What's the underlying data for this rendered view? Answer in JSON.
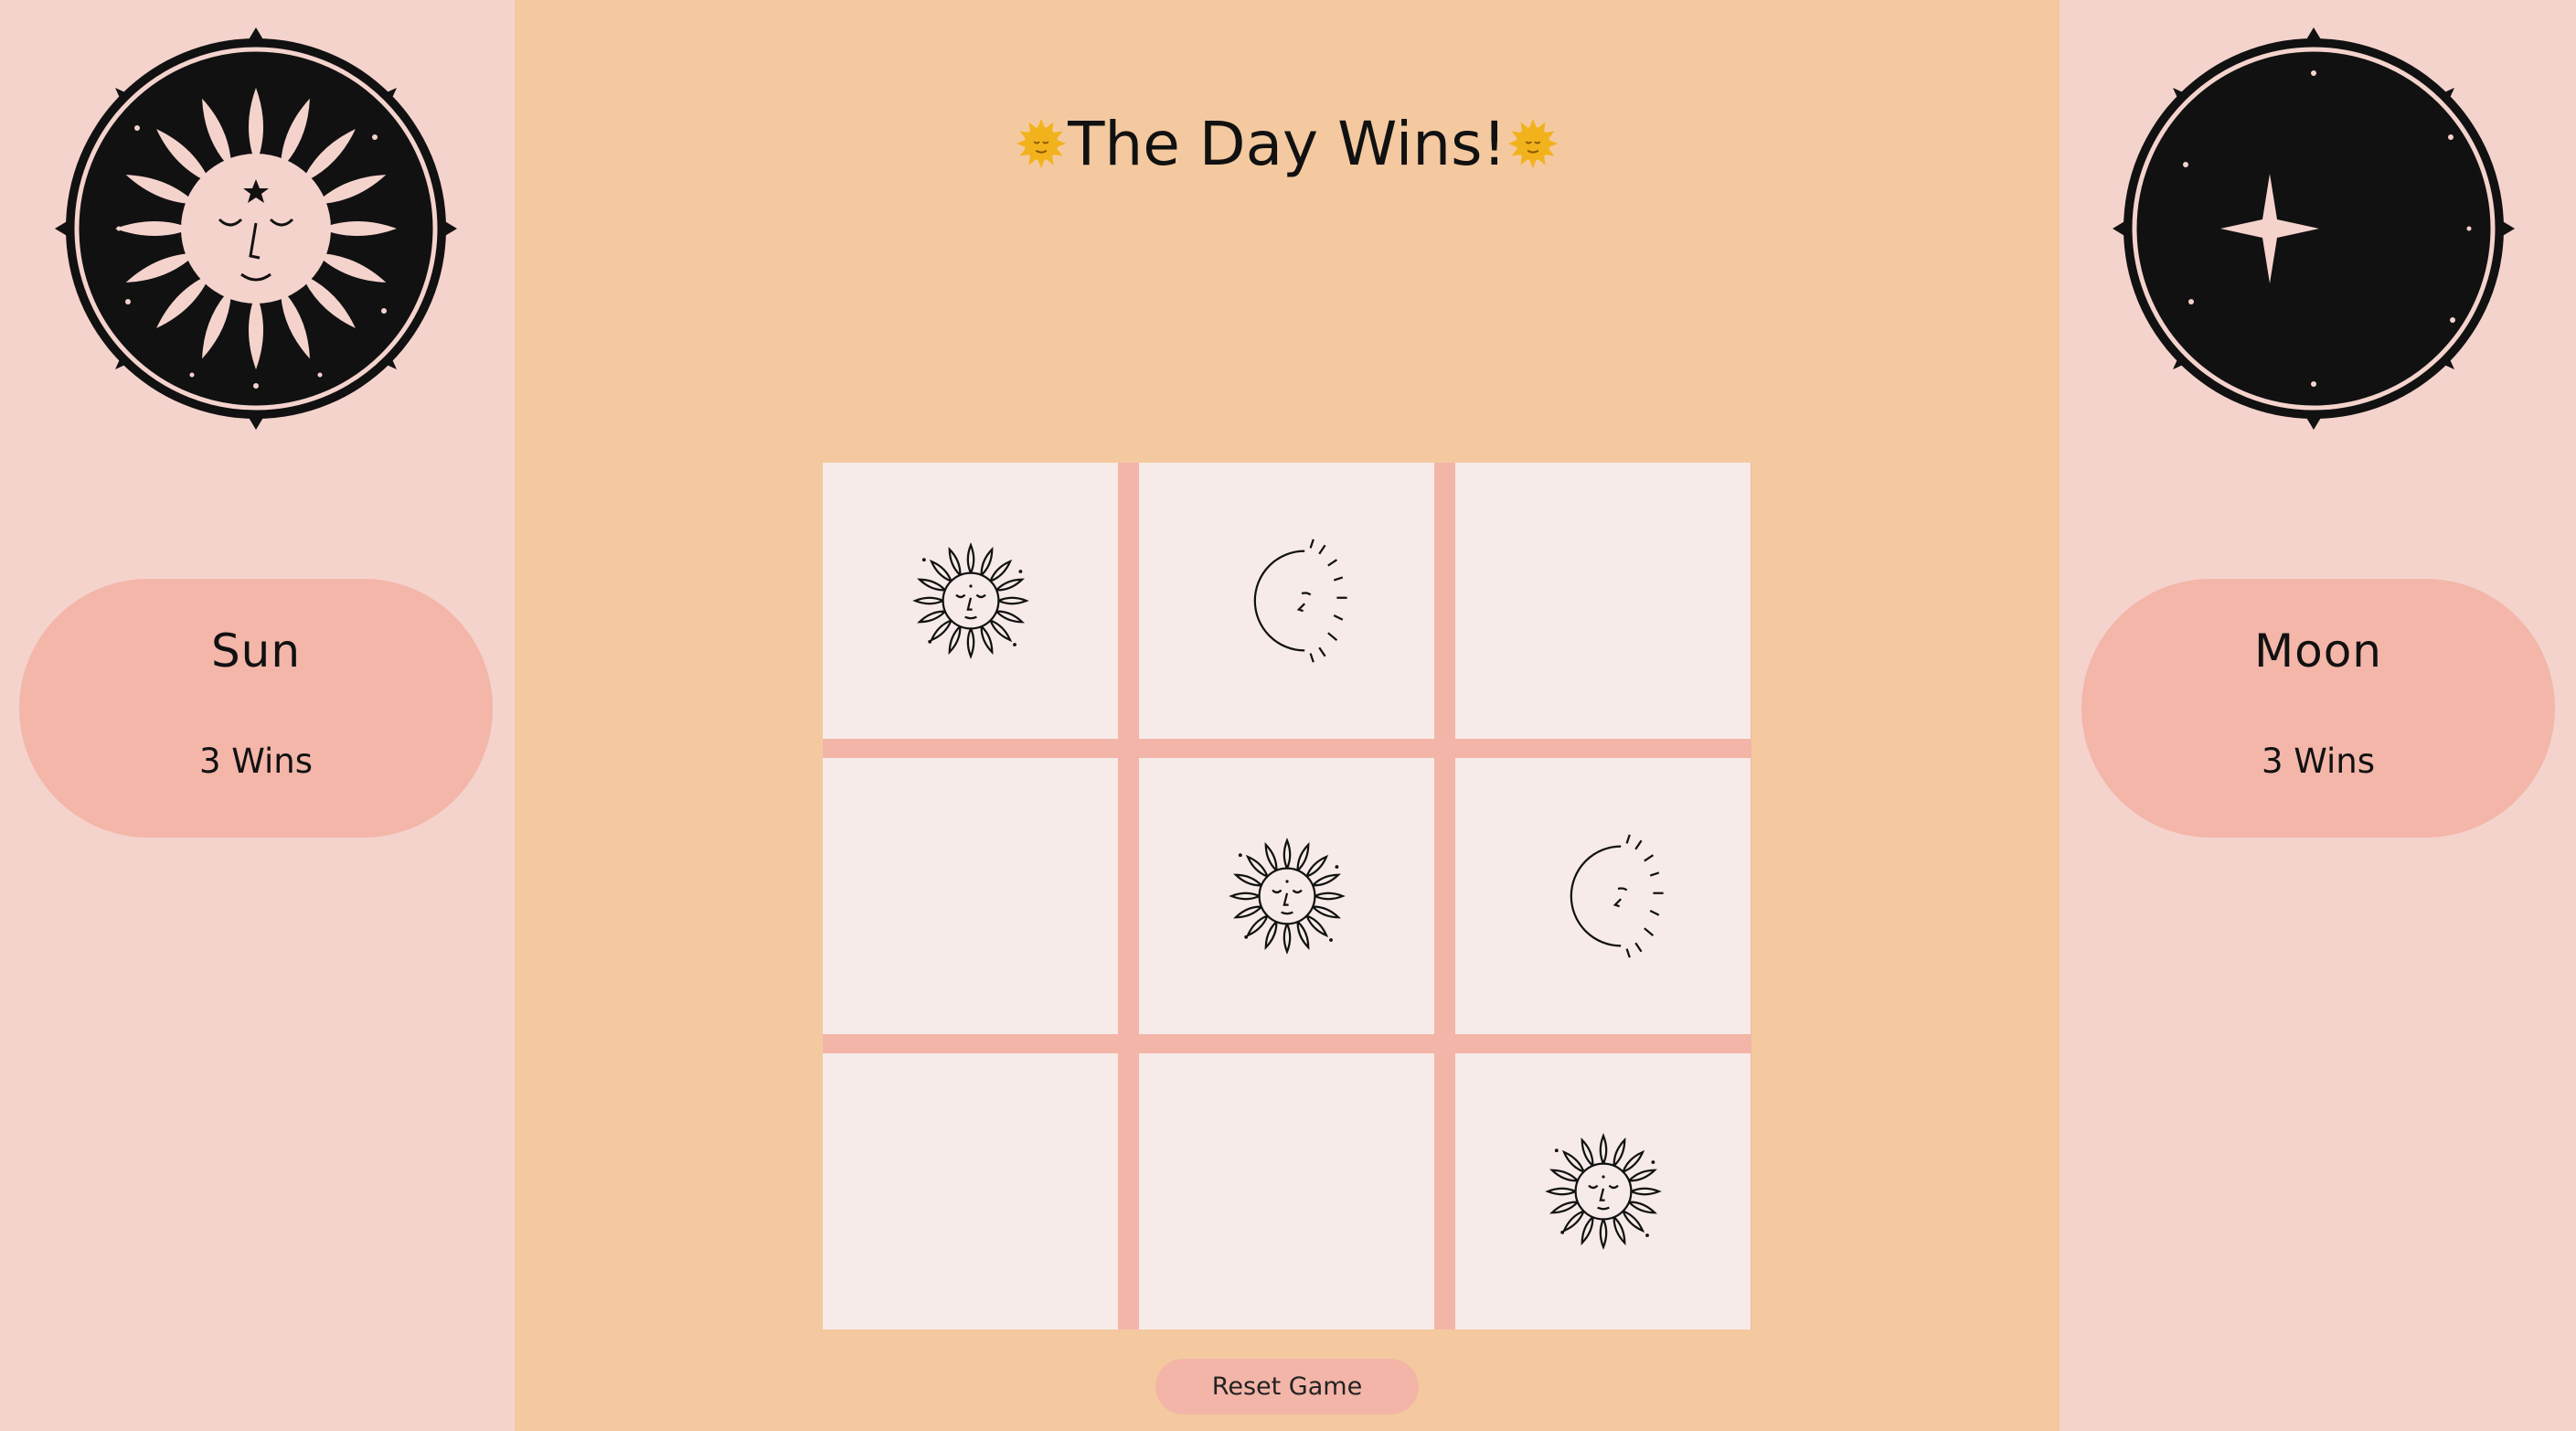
{
  "status": {
    "text": "The Day Wins!",
    "emoji": "sun-face-emoji"
  },
  "players": {
    "sun": {
      "name": "Sun",
      "wins": "3 Wins",
      "emblem": "sun-emblem-icon"
    },
    "moon": {
      "name": "Moon",
      "wins": "3 Wins",
      "emblem": "moon-emblem-icon"
    }
  },
  "board": {
    "cells": [
      "sun",
      "moon",
      "",
      "",
      "sun",
      "moon",
      "",
      "",
      "sun"
    ]
  },
  "reset_label": "Reset Game",
  "colors": {
    "side_bg": "#f5d3cd",
    "center_bg": "#f4c99f",
    "accent": "#f3b5a8",
    "cell_bg": "#f6ebe8"
  }
}
